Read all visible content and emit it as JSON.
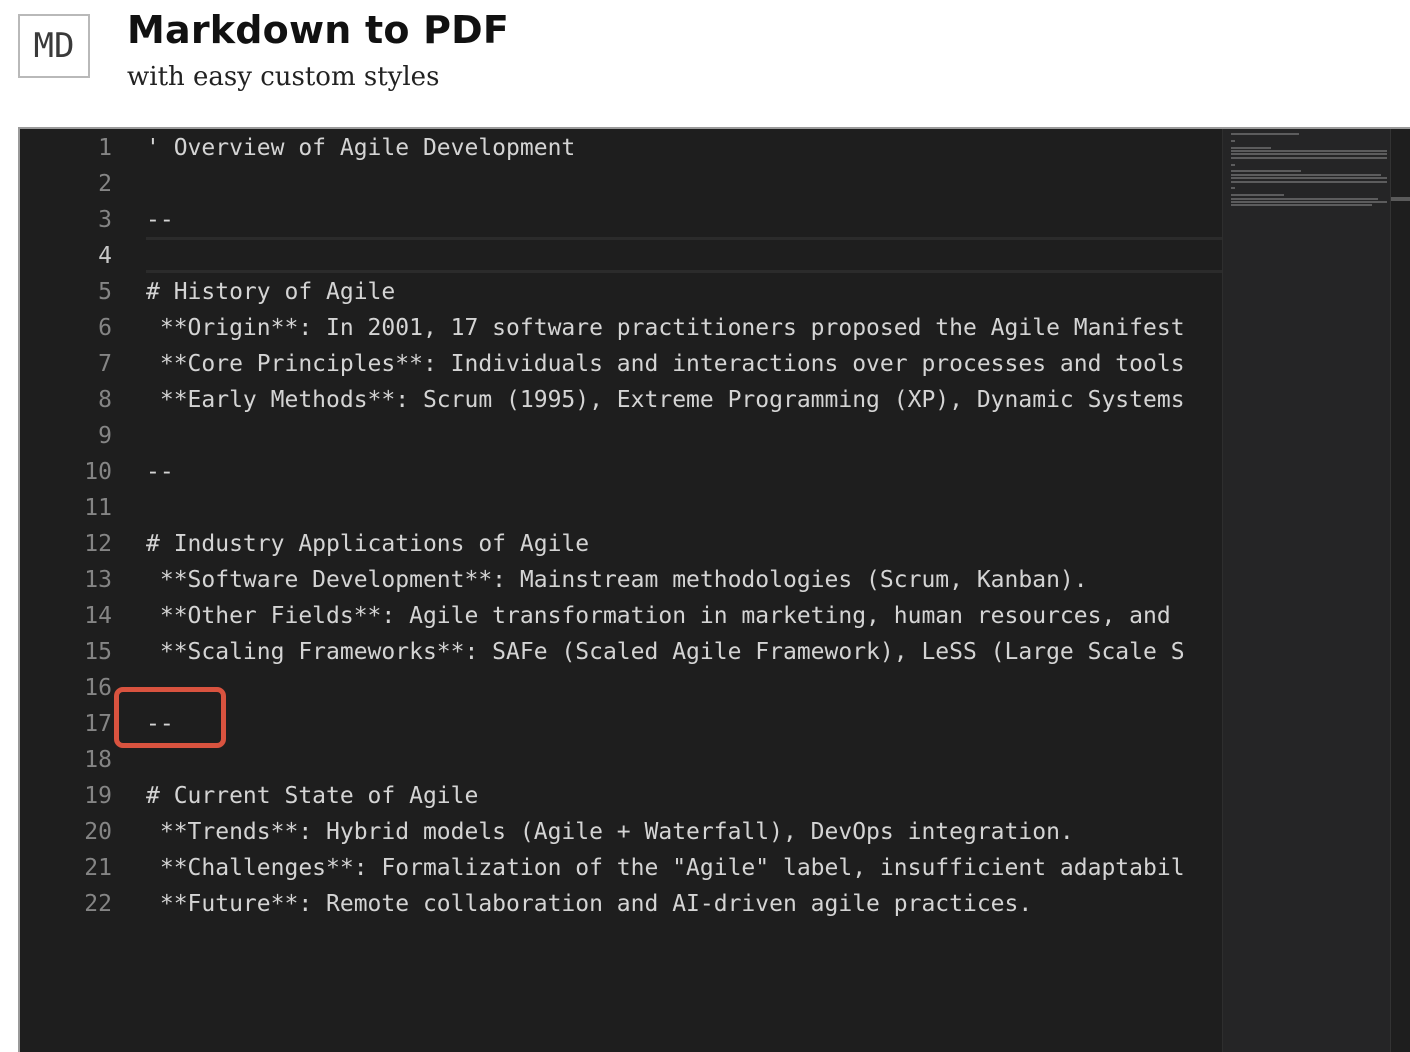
{
  "app": {
    "logo_text": "MD",
    "title": "Markdown to PDF",
    "subtitle": "with easy custom styles"
  },
  "editor": {
    "active_line": 4,
    "lines": [
      {
        "n": "1",
        "text": "' Overview of Agile Development"
      },
      {
        "n": "2",
        "text": ""
      },
      {
        "n": "3",
        "text": "--"
      },
      {
        "n": "4",
        "text": ""
      },
      {
        "n": "5",
        "text": "# History of Agile"
      },
      {
        "n": "6",
        "text": " **Origin**: In 2001, 17 software practitioners proposed the Agile Manifest"
      },
      {
        "n": "7",
        "text": " **Core Principles**: Individuals and interactions over processes and tools"
      },
      {
        "n": "8",
        "text": " **Early Methods**: Scrum (1995), Extreme Programming (XP), Dynamic Systems"
      },
      {
        "n": "9",
        "text": ""
      },
      {
        "n": "10",
        "text": "--"
      },
      {
        "n": "11",
        "text": ""
      },
      {
        "n": "12",
        "text": "# Industry Applications of Agile"
      },
      {
        "n": "13",
        "text": " **Software Development**: Mainstream methodologies (Scrum, Kanban)."
      },
      {
        "n": "14",
        "text": " **Other Fields**: Agile transformation in marketing, human resources, and"
      },
      {
        "n": "15",
        "text": " **Scaling Frameworks**: SAFe (Scaled Agile Framework), LeSS (Large Scale S"
      },
      {
        "n": "16",
        "text": ""
      },
      {
        "n": "17",
        "text": "--"
      },
      {
        "n": "18",
        "text": ""
      },
      {
        "n": "19",
        "text": "# Current State of Agile"
      },
      {
        "n": "20",
        "text": " **Trends**: Hybrid models (Agile + Waterfall), DevOps integration."
      },
      {
        "n": "21",
        "text": " **Challenges**: Formalization of the \"Agile\" label, insufficient adaptabil"
      },
      {
        "n": "22",
        "text": " **Future**: Remote collaboration and AI-driven agile practices."
      }
    ]
  },
  "colors": {
    "editor_bg": "#1e1e1e",
    "text": "#d4d4d4",
    "line_number": "#858585",
    "highlight_box": "#d9533f"
  }
}
